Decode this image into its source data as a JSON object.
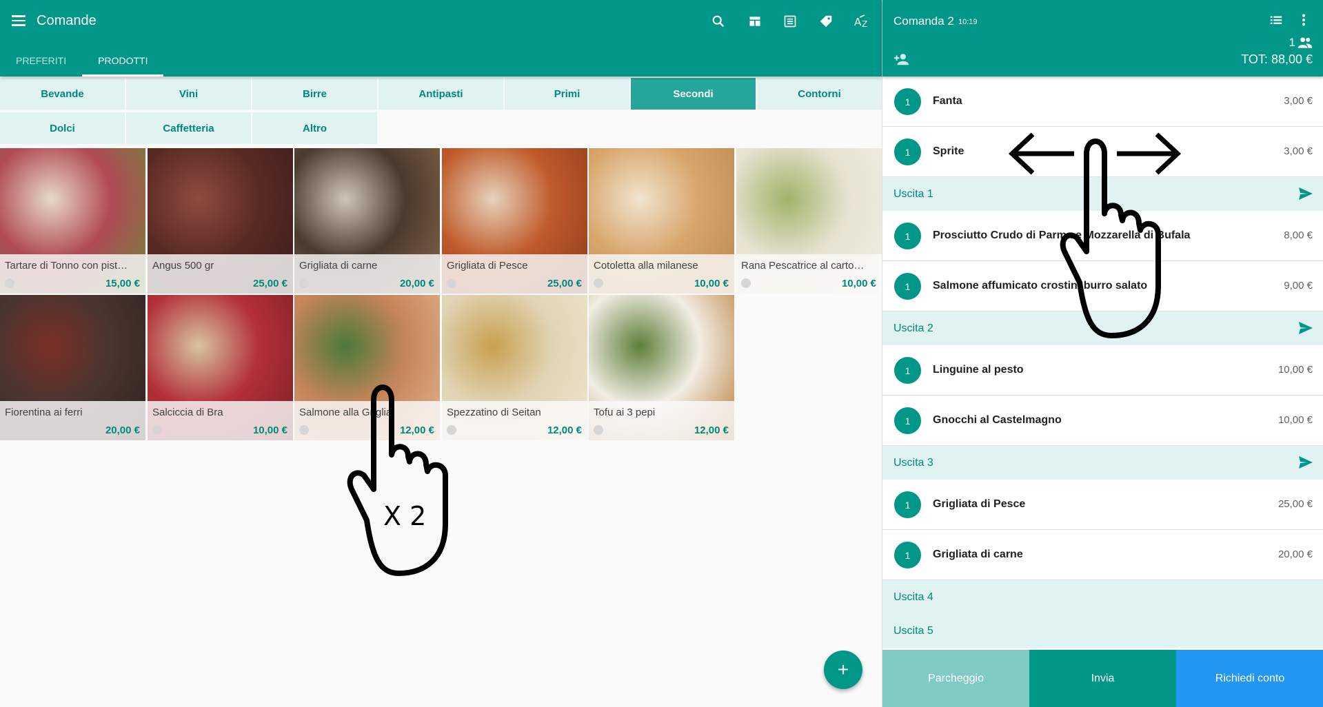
{
  "header": {
    "title": "Comande",
    "tabs": [
      "PREFERITI",
      "PRODOTTI"
    ]
  },
  "categories": [
    "Bevande",
    "Vini",
    "Birre",
    "Antipasti",
    "Primi",
    "Secondi",
    "Contorni",
    "Dolci",
    "Caffetteria",
    "Altro"
  ],
  "active_category": "Secondi",
  "products": [
    {
      "name": "Tartare di Tonno con pist…",
      "price": "15,00 €"
    },
    {
      "name": "Angus 500 gr",
      "price": "25,00 €"
    },
    {
      "name": "Grigliata di carne",
      "price": "20,00 €"
    },
    {
      "name": "Grigliata di Pesce",
      "price": "25,00 €"
    },
    {
      "name": "Cotoletta alla milanese",
      "price": "10,00 €"
    },
    {
      "name": "Rana Pescatrice al carto…",
      "price": "10,00 €"
    },
    {
      "name": "Fiorentina ai ferri",
      "price": "20,00 €"
    },
    {
      "name": "Salciccia di Bra",
      "price": "10,00 €"
    },
    {
      "name": "Salmone alla Griglia",
      "price": "12,00 €"
    },
    {
      "name": "Spezzatino di Seitan",
      "price": "12,00 €"
    },
    {
      "name": "Tofu ai 3 pepi",
      "price": "12,00 €"
    }
  ],
  "fab_label": "+",
  "order": {
    "title": "Comanda 2",
    "time": "10:19",
    "guests": "1",
    "total": "TOT: 88,00 €",
    "rows": [
      {
        "type": "item",
        "qty": "1",
        "name": "Fanta",
        "price": "3,00 €"
      },
      {
        "type": "item",
        "qty": "1",
        "name": "Sprite",
        "price": "3,00 €"
      },
      {
        "type": "course",
        "name": "Uscita 1",
        "send": true
      },
      {
        "type": "item",
        "qty": "1",
        "name": "Prosciutto Crudo di Parma e Mozzarella di Bufala",
        "price": "8,00 €"
      },
      {
        "type": "item",
        "qty": "1",
        "name": "Salmone affumicato crostini burro salato",
        "price": "9,00 €"
      },
      {
        "type": "course",
        "name": "Uscita 2",
        "send": true
      },
      {
        "type": "item",
        "qty": "1",
        "name": "Linguine al pesto",
        "price": "10,00 €"
      },
      {
        "type": "item",
        "qty": "1",
        "name": "Gnocchi al Castelmagno",
        "price": "10,00 €"
      },
      {
        "type": "course",
        "name": "Uscita 3",
        "send": true
      },
      {
        "type": "item",
        "qty": "1",
        "name": "Grigliata di Pesce",
        "price": "25,00 €"
      },
      {
        "type": "item",
        "qty": "1",
        "name": "Grigliata di carne",
        "price": "20,00 €"
      },
      {
        "type": "course",
        "name": "Uscita 4",
        "send": false
      },
      {
        "type": "course",
        "name": "Uscita 5",
        "send": false
      }
    ]
  },
  "footer": {
    "parcheggio": "Parcheggio",
    "invia": "Invia",
    "conto": "Richiedi conto"
  },
  "gesture": {
    "double_tap_label": "X 2"
  },
  "colors": {
    "primary": "#009688",
    "primary_light": "#e0f2f1",
    "accent_teal": "#26a69a",
    "parcheggio": "#80cbc4",
    "conto": "#2196f3"
  }
}
